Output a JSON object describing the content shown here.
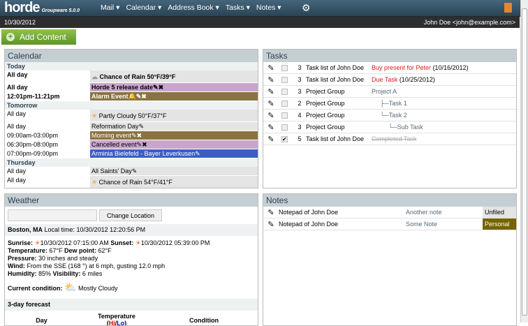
{
  "header": {
    "logo": "horde",
    "product": "Groupware 5.0.0",
    "menu": [
      "Mail ▾",
      "Calendar ▾",
      "Address Book ▾",
      "Tasks ▾",
      "Notes ▾"
    ],
    "date": "10/30/2012",
    "user": "John Doe <john@example.com>"
  },
  "add_content": "Add Content",
  "calendar": {
    "title": "Calendar",
    "days": [
      {
        "name": "Today",
        "rows": [
          {
            "time": "All day",
            "event": "Chance of Rain 50°F/39°F",
            "icon": "☁",
            "color": "#e4e4e4",
            "bold": true
          },
          {
            "time": "All day",
            "event": "Horde 5 release date",
            "edit": "✎✖",
            "color": "#c8a6cc",
            "bold": true
          },
          {
            "time": "12:01pm-11:21pm",
            "event": "Alarm Event",
            "edit": "🔔✎✖",
            "color": "#8a7341",
            "text": "#fff",
            "bold": true
          }
        ]
      },
      {
        "name": "Tomorrow",
        "rows": [
          {
            "time": "All day",
            "event": "Partly Cloudy 50°F/37°F",
            "icon": "☀",
            "color": "#e4e4e4"
          },
          {
            "time": "All day",
            "event": "Reformation Day",
            "edit": "✎",
            "color": "#e4e4e4"
          },
          {
            "time": "09:00am-03:00pm",
            "event": "Morning event",
            "edit": "✎✖",
            "color": "#8a7341",
            "text": "#fff"
          },
          {
            "time": "06:30pm-08:00pm",
            "event": "Cancelled event",
            "edit": "✎✖",
            "color": "#c8a6cc"
          },
          {
            "time": "07:00pm-09:00pm",
            "event": "Arminia Bielefeld - Bayer Leverkusen",
            "edit": "✎",
            "color": "#3b5ec0",
            "text": "#fff"
          }
        ]
      },
      {
        "name": "Thursday",
        "rows": [
          {
            "time": "All day",
            "event": "All Saints' Day",
            "edit": "✎",
            "color": "#e4e4e4"
          },
          {
            "time": "All day",
            "event": "Chance of Rain 54°F/41°F",
            "icon": "☀",
            "color": "#e4e4e4"
          }
        ]
      }
    ]
  },
  "tasks": {
    "title": "Tasks",
    "rows": [
      {
        "priority": "3",
        "list": "Task list of John Doe",
        "name": "Buy present for Peter",
        "due": "(10/16/2012)",
        "style": "red",
        "done": false
      },
      {
        "priority": "3",
        "list": "Task list of John Doe",
        "name": "Due Task",
        "due": "(10/25/2012)",
        "style": "red",
        "done": false
      },
      {
        "priority": "3",
        "list": "Project Group",
        "name": "Project A",
        "style": "gr",
        "done": false
      },
      {
        "priority": "2",
        "list": "Project Group",
        "name": "├─Task 1",
        "style": "gr",
        "indent": 1,
        "done": false
      },
      {
        "priority": "4",
        "list": "Project Group",
        "name": "└─Task 2",
        "style": "gr",
        "indent": 1,
        "done": false
      },
      {
        "priority": "3",
        "list": "Project Group",
        "name": "└─Sub Task",
        "style": "gr",
        "indent": 2,
        "done": false
      },
      {
        "priority": "5",
        "list": "Task list of John Doe",
        "name": "Completed Task",
        "style": "strike",
        "done": true
      }
    ]
  },
  "weather": {
    "title": "Weather",
    "location_value": "",
    "change_location": "Change Location",
    "city": "Boston, MA",
    "local_time": "Local time: 10/30/2012 12:20:56 PM",
    "sunrise_label": "Sunrise:",
    "sunrise": "10/30/2012 07:15:00 AM",
    "sunset_label": "Sunset:",
    "sunset": "10/30/2012 05:39:00 PM",
    "temperature_label": "Temperature:",
    "temperature": "67°F",
    "dew_label": "Dew point:",
    "dew": "62°F",
    "pressure_label": "Pressure:",
    "pressure": "30 inches and steady",
    "wind_label": "Wind:",
    "wind": "From the SSE (168 °) at 6 mph, gusting 12.0 mph",
    "humidity_label": "Humidity:",
    "humidity": "85%",
    "visibility_label": "Visibility:",
    "visibility": "6 miles",
    "condition_label": "Current condition:",
    "condition": "Mostly Cloudy",
    "forecast_title": "3-day forecast",
    "col_day": "Day",
    "col_temp": "Temperature",
    "hi": "Hi",
    "lo": "Lo",
    "col_cond": "Condition"
  },
  "notes": {
    "title": "Notes",
    "rows": [
      {
        "notepad": "Notepad of John Doe",
        "title": "Another note",
        "category": "Unfiled",
        "cat_color": "#e4e4e4",
        "cat_text": "#000"
      },
      {
        "notepad": "Notepad of John Doe",
        "title": "Some Note",
        "category": "Personal",
        "cat_color": "#756400",
        "cat_text": "#fff"
      }
    ]
  }
}
